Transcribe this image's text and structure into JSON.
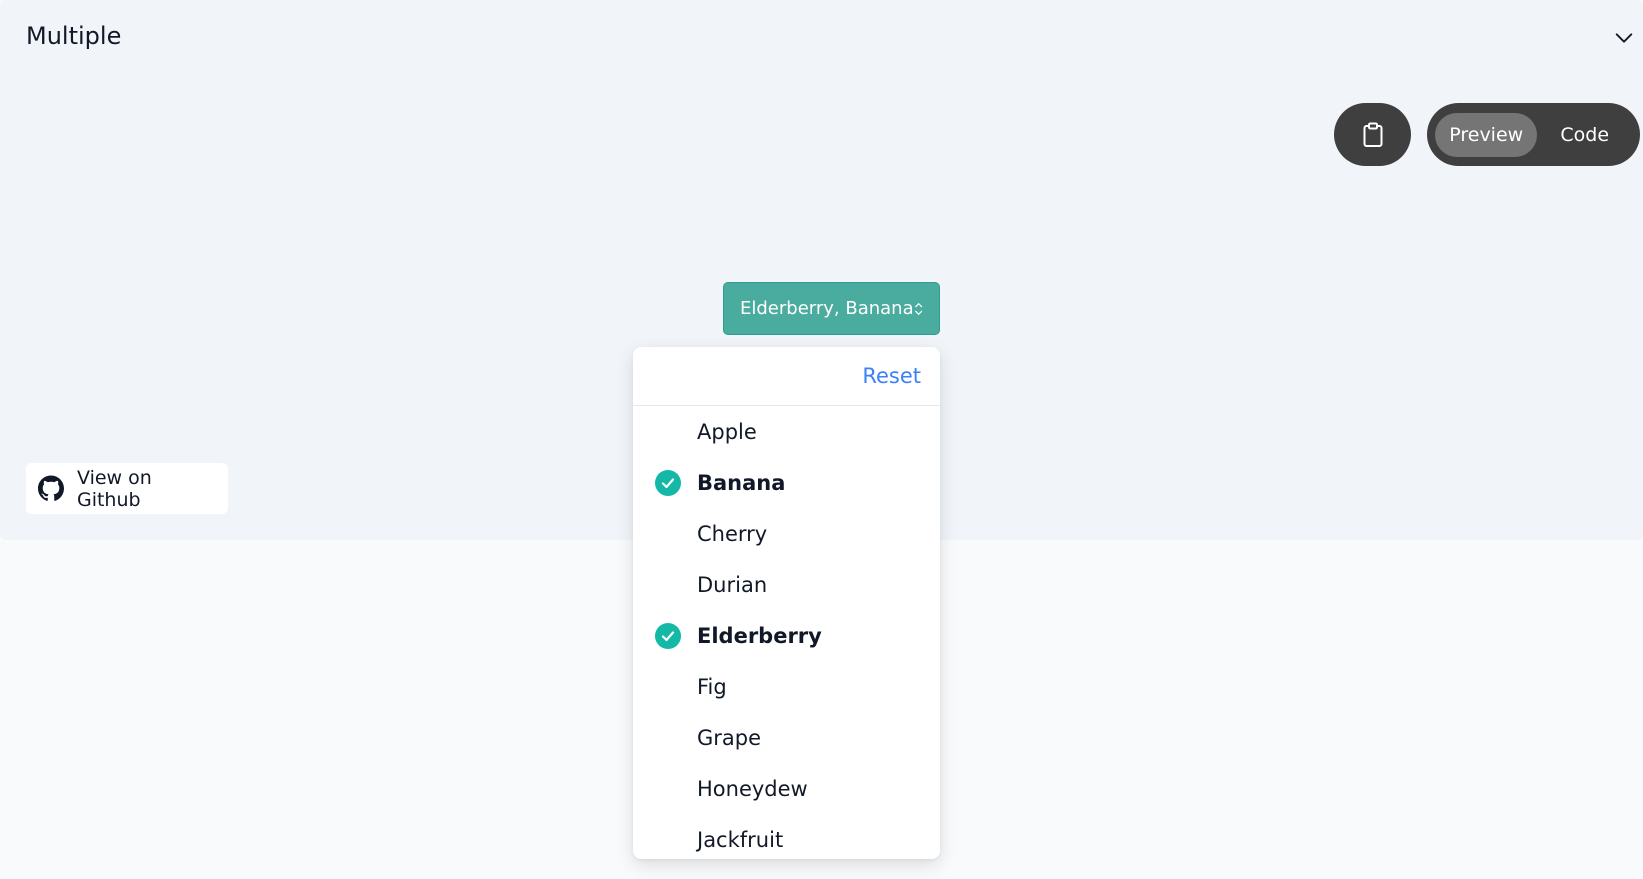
{
  "section": {
    "title": "Multiple"
  },
  "toolbar": {
    "preview_label": "Preview",
    "code_label": "Code",
    "active_view": "Preview"
  },
  "select": {
    "value": "Elderberry, Banana",
    "accent_color": "#4aac9e"
  },
  "dropdown": {
    "reset_label": "Reset",
    "options": [
      {
        "label": "Apple",
        "selected": false
      },
      {
        "label": "Banana",
        "selected": true
      },
      {
        "label": "Cherry",
        "selected": false
      },
      {
        "label": "Durian",
        "selected": false
      },
      {
        "label": "Elderberry",
        "selected": true
      },
      {
        "label": "Fig",
        "selected": false
      },
      {
        "label": "Grape",
        "selected": false
      },
      {
        "label": "Honeydew",
        "selected": false
      },
      {
        "label": "Jackfruit",
        "selected": false
      }
    ]
  },
  "github": {
    "label": "View on Github"
  },
  "icons": {
    "collapse": "chevron-down-icon",
    "copy": "clipboard-icon",
    "select": "chevron-up-down-icon",
    "github": "github-icon",
    "check": "check-circle-icon"
  }
}
